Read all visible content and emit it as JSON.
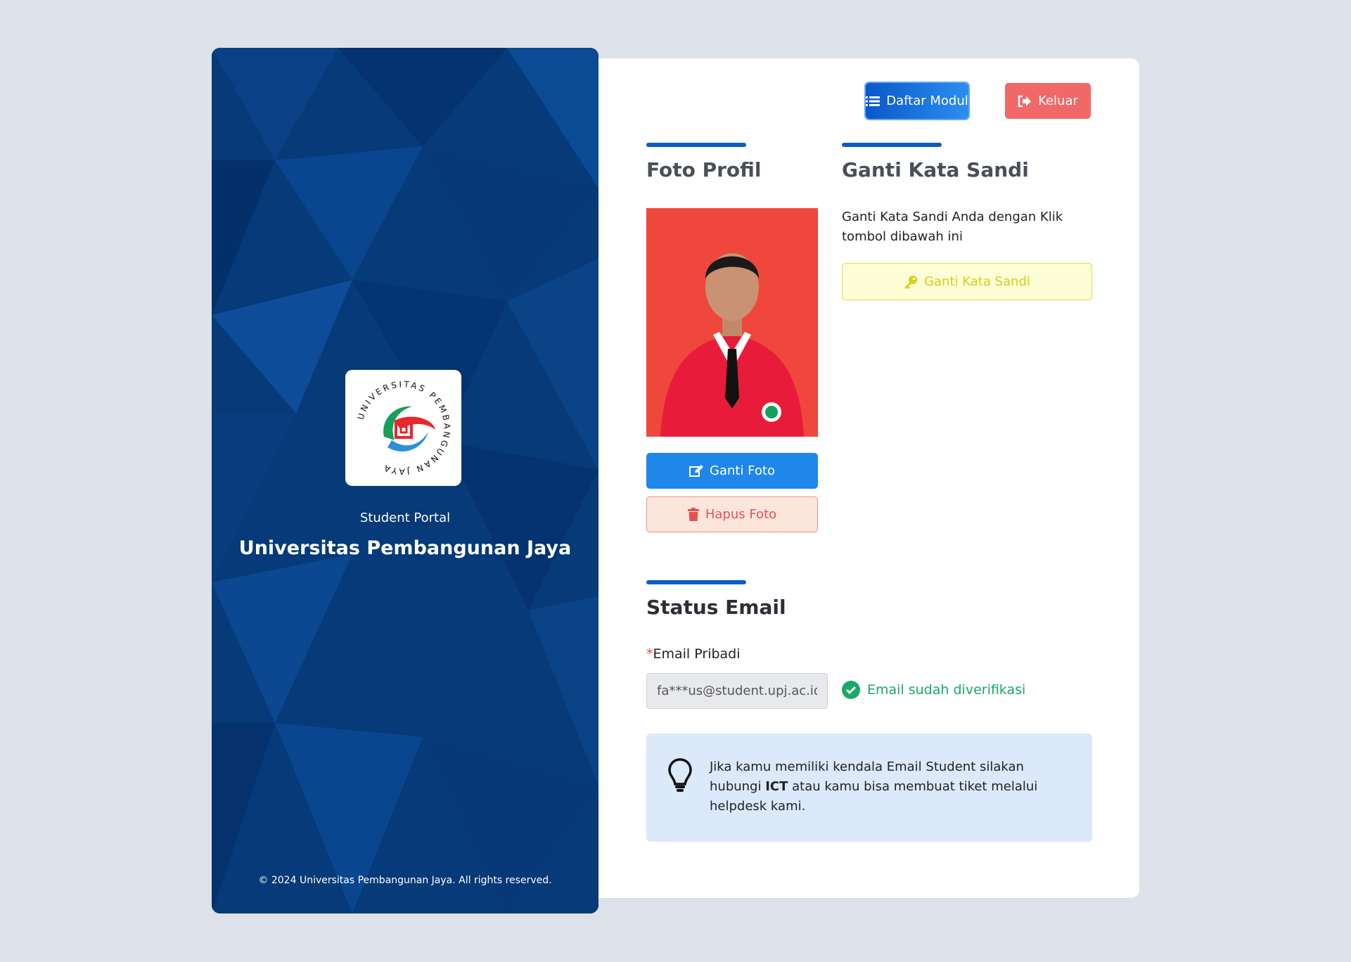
{
  "brand": {
    "portal_label": "Student Portal",
    "university_name": "Universitas Pembangunan Jaya",
    "logo_text": "UNIVERSITAS PEMBANGUNAN JAYA",
    "copyright": "© 2024 Universitas Pembangunan Jaya. All rights reserved."
  },
  "toolbar": {
    "modules_label": "Daftar Modul",
    "logout_label": "Keluar"
  },
  "profile_photo": {
    "title": "Foto Profil",
    "change_label": "Ganti Foto",
    "delete_label": "Hapus Foto"
  },
  "password": {
    "title": "Ganti Kata Sandi",
    "description": "Ganti Kata Sandi Anda dengan Klik tombol dibawah ini",
    "button_label": "Ganti Kata Sandi"
  },
  "email_status": {
    "title": "Status Email",
    "required_mark": "*",
    "field_label": "Email Pribadi",
    "field_value": "fa***us@student.upj.ac.id",
    "verified_text": "Email sudah diverifikasi"
  },
  "info": {
    "text_before": "Jika kamu memiliki kendala Email Student silakan hubungi ",
    "text_bold": "ICT",
    "text_after": " atau kamu bisa membuat tiket melalui helpdesk kami."
  },
  "colors": {
    "accent": "#0b5ec2",
    "panel_bg": "#06336a",
    "danger": "#f06868",
    "success": "#1aa86a",
    "warning": "#d6cf1a"
  }
}
